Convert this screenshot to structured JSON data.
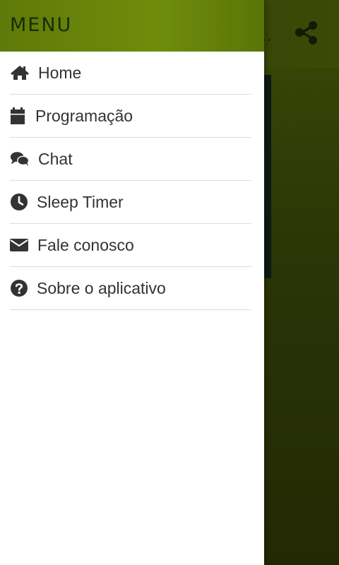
{
  "drawer": {
    "title": "MENU",
    "items": [
      {
        "label": "Home",
        "icon": "home-icon"
      },
      {
        "label": "Programação",
        "icon": "calendar-icon"
      },
      {
        "label": "Chat",
        "icon": "chat-icon"
      },
      {
        "label": "Sleep Timer",
        "icon": "clock-icon"
      },
      {
        "label": "Fale conosco",
        "icon": "envelope-icon"
      },
      {
        "label": "Sobre o aplicativo",
        "icon": "question-icon"
      }
    ]
  },
  "background": {
    "title_fragment": "O...",
    "share_icon": "share-icon"
  },
  "colors": {
    "drawer_header": "#6f8c0b",
    "title_text": "#1a2c08",
    "label_text": "#333333",
    "divider": "#dcdcdc"
  }
}
